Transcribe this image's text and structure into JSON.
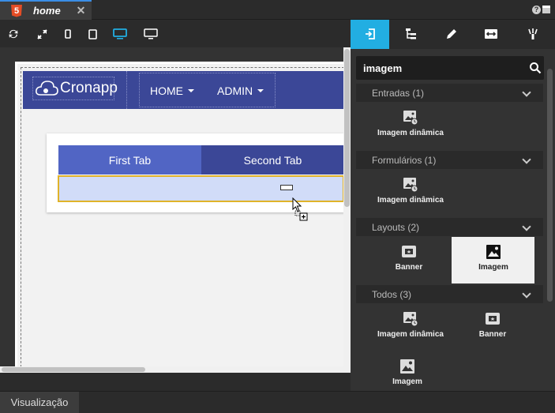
{
  "editor_tab": {
    "name": "home",
    "close": "✕",
    "file_type": "5"
  },
  "window_controls": {
    "help": "?"
  },
  "device_toolbar": [
    {
      "name": "refresh-icon"
    },
    {
      "name": "fullscreen-icon"
    },
    {
      "name": "phone-icon"
    },
    {
      "name": "tablet-icon"
    },
    {
      "name": "desktop-icon",
      "active": true
    },
    {
      "name": "large-monitor-icon"
    }
  ],
  "preview": {
    "brand": "Cronapp",
    "nav": [
      {
        "label": "HOME"
      },
      {
        "label": "ADMIN"
      }
    ],
    "tabs": [
      {
        "label": "First Tab"
      },
      {
        "label": "Second Tab"
      }
    ]
  },
  "right_toolbar": [
    {
      "name": "components-icon",
      "active": true
    },
    {
      "name": "tree-structure-icon"
    },
    {
      "name": "pencil-icon"
    },
    {
      "name": "resize-horizontal-icon"
    },
    {
      "name": "magic-wand-icon"
    }
  ],
  "search": {
    "value": "imagem"
  },
  "sections": [
    {
      "title": "Entradas (1)",
      "items": [
        {
          "label": "Imagem dinâmica",
          "icon": "dynamic-image-icon"
        }
      ]
    },
    {
      "title": "Formulários (1)",
      "items": [
        {
          "label": "Imagem dinâmica",
          "icon": "dynamic-image-icon"
        }
      ]
    },
    {
      "title": "Layouts (2)",
      "items": [
        {
          "label": "Banner",
          "icon": "banner-icon"
        },
        {
          "label": "Imagem",
          "icon": "image-icon",
          "selected": true
        }
      ]
    },
    {
      "title": "Todos (3)",
      "items": [
        {
          "label": "Imagem dinâmica",
          "icon": "dynamic-image-icon"
        },
        {
          "label": "Banner",
          "icon": "banner-icon"
        },
        {
          "label": "Imagem",
          "icon": "image-icon"
        }
      ]
    }
  ],
  "bottom": {
    "tab": "Visualização"
  },
  "colors": {
    "accent": "#22aee2",
    "navbar": "#3b4797",
    "tab_active": "#5165c4",
    "selection_border": "#e0b32a"
  }
}
